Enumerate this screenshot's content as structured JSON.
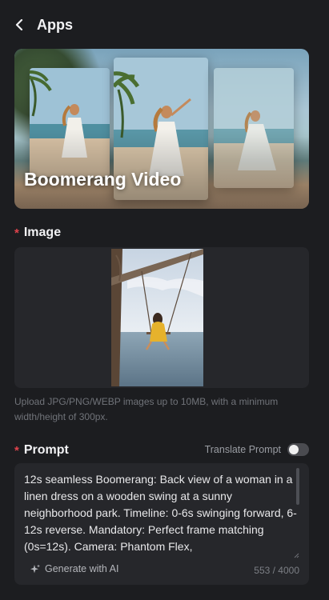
{
  "header": {
    "title": "Apps",
    "back_icon": "chevron-left-icon"
  },
  "banner": {
    "title": "Boomerang Video"
  },
  "image_section": {
    "label": "Image",
    "required_mark": "*",
    "hint": "Upload JPG/PNG/WEBP images up to 10MB, with a minimum width/height of 300px."
  },
  "prompt_section": {
    "label": "Prompt",
    "required_mark": "*",
    "translate_label": "Translate Prompt",
    "translate_on": false,
    "value": "12s seamless Boomerang: Back view of a woman in a linen dress on a wooden swing at a sunny neighborhood park. Timeline: 0-6s swinging forward, 6-12s reverse. Mandatory: Perfect frame matching (0s=12s). Camera: Phantom Flex,",
    "generate_label": "Generate with AI",
    "generate_icon": "sparkle-icon",
    "counter": "553 / 4000"
  },
  "colors": {
    "background": "#1c1d20",
    "panel": "#26272b",
    "required": "#e0434c"
  }
}
